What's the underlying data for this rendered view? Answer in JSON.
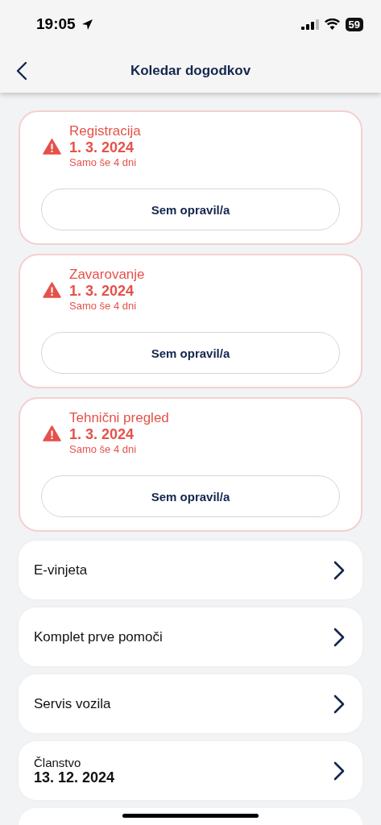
{
  "status_bar": {
    "time": "19:05",
    "battery": "59"
  },
  "header": {
    "title": "Koledar dogodkov"
  },
  "events": [
    {
      "kind": "alert",
      "title": "Registracija",
      "date": "1. 3. 2024",
      "remaining": "Samo še 4 dni",
      "button": "Sem opravil/a"
    },
    {
      "kind": "alert",
      "title": "Zavarovanje",
      "date": "1. 3. 2024",
      "remaining": "Samo še 4 dni",
      "button": "Sem opravil/a"
    },
    {
      "kind": "alert",
      "title": "Tehnični pregled",
      "date": "1. 3. 2024",
      "remaining": "Samo še 4 dni",
      "button": "Sem opravil/a"
    },
    {
      "kind": "item",
      "title": "E-vinjeta"
    },
    {
      "kind": "item",
      "title": "Komplet prve pomoči"
    },
    {
      "kind": "item",
      "title": "Servis vozila"
    },
    {
      "kind": "dated",
      "title": "Članstvo",
      "date": "13. 12. 2024"
    }
  ]
}
